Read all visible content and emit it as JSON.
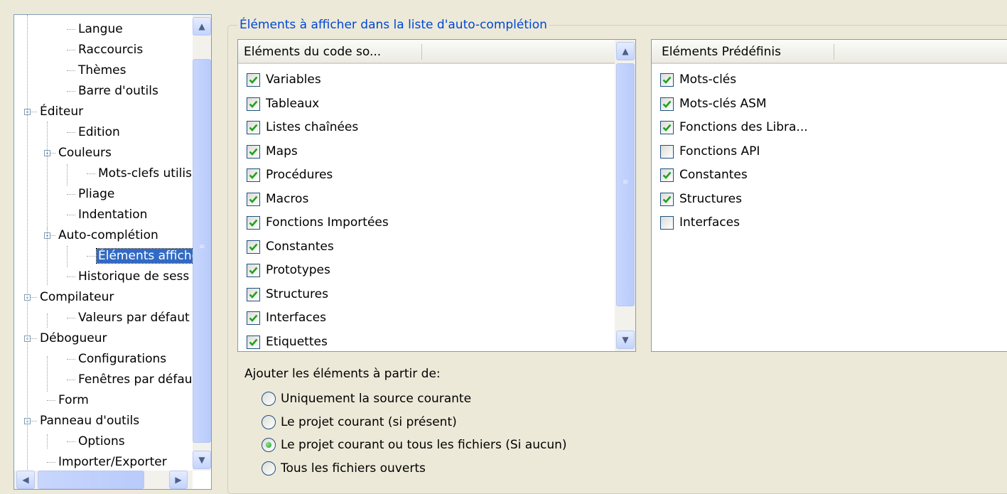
{
  "tree": {
    "nodes": [
      {
        "label": "Langue",
        "expander": ""
      },
      {
        "label": "Raccourcis",
        "expander": ""
      },
      {
        "label": "Thèmes",
        "expander": ""
      },
      {
        "label": "Barre d'outils",
        "expander": ""
      },
      {
        "label": "Éditeur",
        "expander": "-"
      },
      {
        "label": "Edition",
        "expander": ""
      },
      {
        "label": "Couleurs",
        "expander": "-"
      },
      {
        "label": "Mots-clefs utilisa",
        "expander": ""
      },
      {
        "label": "Pliage",
        "expander": ""
      },
      {
        "label": "Indentation",
        "expander": ""
      },
      {
        "label": "Auto-complétion",
        "expander": "-"
      },
      {
        "label": "Éléments affiche",
        "expander": ""
      },
      {
        "label": "Historique de sess",
        "expander": ""
      },
      {
        "label": "Compilateur",
        "expander": "-"
      },
      {
        "label": "Valeurs par défaut",
        "expander": ""
      },
      {
        "label": "Débogueur",
        "expander": "-"
      },
      {
        "label": "Configurations",
        "expander": ""
      },
      {
        "label": "Fenêtres par défau",
        "expander": ""
      },
      {
        "label": "Form",
        "expander": ""
      },
      {
        "label": "Panneau d'outils",
        "expander": "-"
      },
      {
        "label": "Options",
        "expander": ""
      },
      {
        "label": "Importer/Exporter",
        "expander": ""
      }
    ],
    "selected": "Éléments affiche"
  },
  "group": {
    "title": "Éléments à afficher dans la liste d'auto-complétion"
  },
  "code_list": {
    "header": "Eléments du code so...",
    "items": [
      {
        "label": "Variables",
        "checked": true
      },
      {
        "label": "Tableaux",
        "checked": true
      },
      {
        "label": "Listes chaînées",
        "checked": true
      },
      {
        "label": "Maps",
        "checked": true
      },
      {
        "label": "Procédures",
        "checked": true
      },
      {
        "label": "Macros",
        "checked": true
      },
      {
        "label": "Fonctions Importées",
        "checked": true
      },
      {
        "label": "Constantes",
        "checked": true
      },
      {
        "label": "Prototypes",
        "checked": true
      },
      {
        "label": "Structures",
        "checked": true
      },
      {
        "label": "Interfaces",
        "checked": true
      },
      {
        "label": "Etiquettes",
        "checked": true
      }
    ]
  },
  "predef_list": {
    "header": "Eléments Prédéfinis",
    "items": [
      {
        "label": "Mots-clés",
        "checked": true
      },
      {
        "label": "Mots-clés ASM",
        "checked": true
      },
      {
        "label": "Fonctions des Libra...",
        "checked": true
      },
      {
        "label": "Fonctions API",
        "checked": false
      },
      {
        "label": "Constantes",
        "checked": true
      },
      {
        "label": "Structures",
        "checked": true
      },
      {
        "label": "Interfaces",
        "checked": false
      }
    ]
  },
  "source": {
    "label": "Ajouter les éléments à partir de:",
    "options": [
      {
        "label": "Uniquement la source courante",
        "selected": false
      },
      {
        "label": "Le projet courant (si présent)",
        "selected": false
      },
      {
        "label": "Le projet courant ou tous les fichiers (Si aucun)",
        "selected": true
      },
      {
        "label": "Tous les fichiers ouverts",
        "selected": false
      }
    ]
  },
  "icons": {
    "scroll_up": "chevron-up-icon",
    "scroll_down": "chevron-down-icon",
    "scroll_left": "chevron-left-icon",
    "scroll_right": "chevron-right-icon",
    "check": "checkmark-icon"
  },
  "colors": {
    "check_green": "#21a121",
    "selection_blue": "#316ac5",
    "group_title_blue": "#0046d5",
    "dialog_bg": "#ece9d8"
  }
}
